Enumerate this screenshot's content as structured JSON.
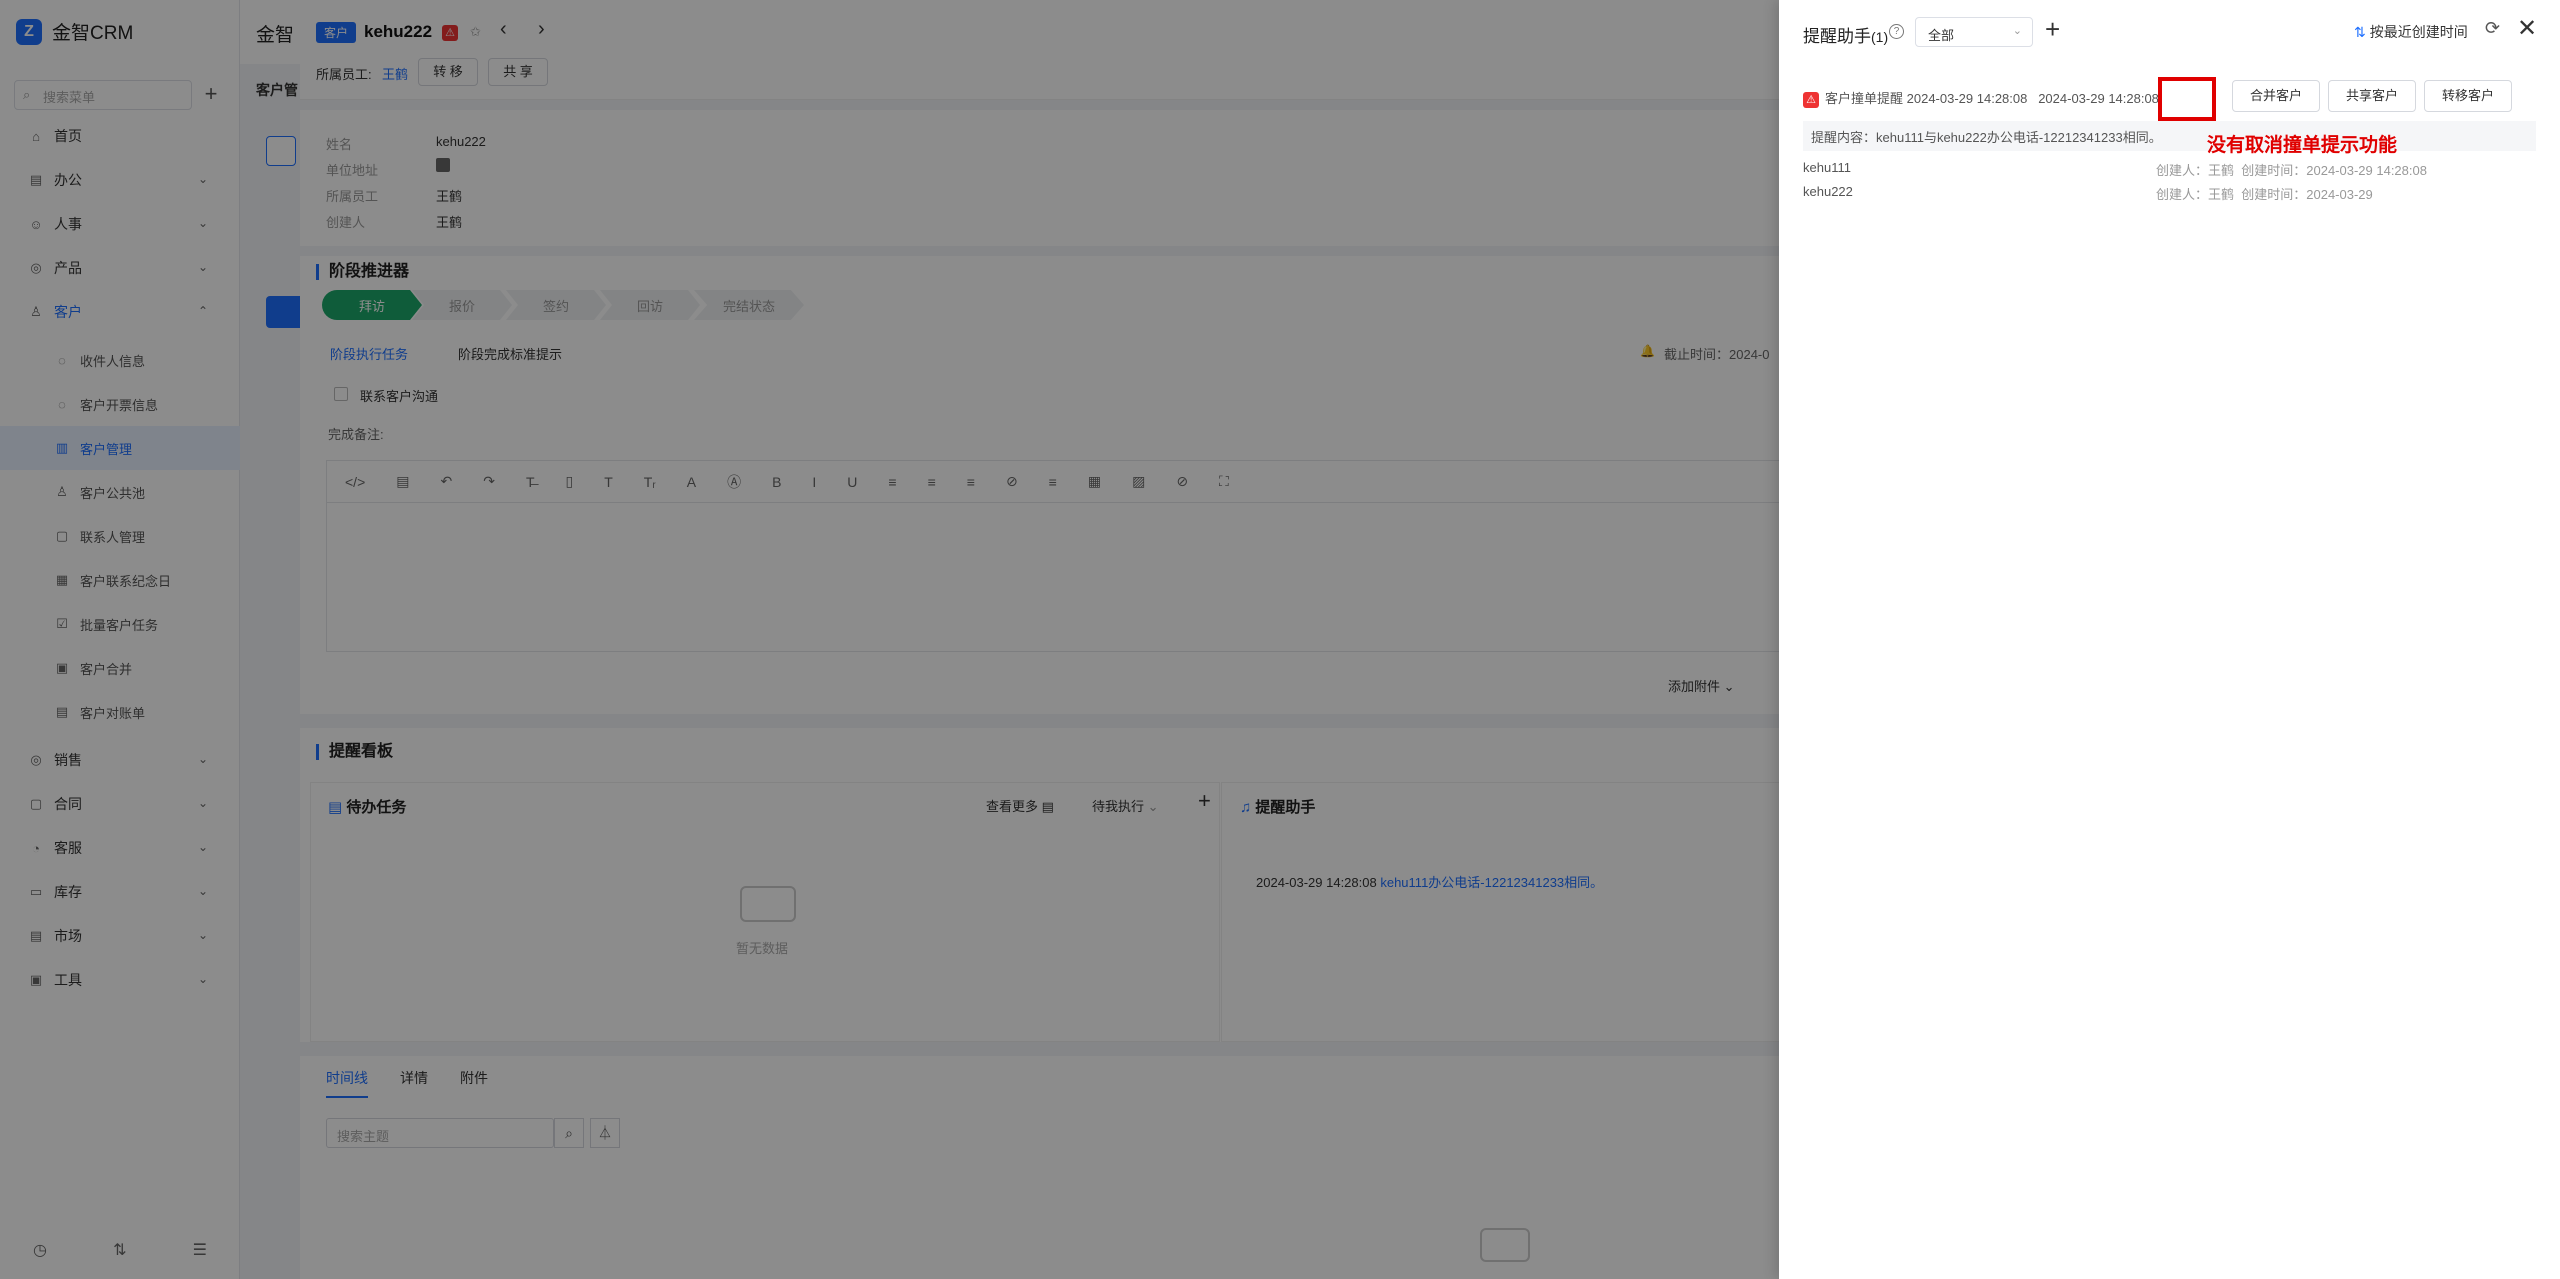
{
  "app": {
    "logo": "金智CRM",
    "logo_mark": "Z"
  },
  "sidebar": {
    "search_placeholder": "搜索菜单",
    "items": [
      {
        "label": "首页",
        "icon": "⌂"
      },
      {
        "label": "办公",
        "icon": "▤"
      },
      {
        "label": "人事",
        "icon": "☺"
      },
      {
        "label": "产品",
        "icon": "◎"
      },
      {
        "label": "客户",
        "icon": "♙"
      },
      {
        "label": "收件人信息",
        "icon": "◌"
      },
      {
        "label": "客户开票信息",
        "icon": "◌"
      },
      {
        "label": "客户管理",
        "icon": "▥"
      },
      {
        "label": "客户公共池",
        "icon": "♙"
      },
      {
        "label": "联系人管理",
        "icon": "▢"
      },
      {
        "label": "客户联系纪念日",
        "icon": "▦"
      },
      {
        "label": "批量客户任务",
        "icon": "☑"
      },
      {
        "label": "客户合并",
        "icon": "▣"
      },
      {
        "label": "客户对账单",
        "icon": "▤"
      },
      {
        "label": "销售",
        "icon": "◎"
      },
      {
        "label": "合同",
        "icon": "▢"
      },
      {
        "label": "客服",
        "icon": "◔"
      },
      {
        "label": "库存",
        "icon": "▭"
      },
      {
        "label": "市场",
        "icon": "▤"
      },
      {
        "label": "工具",
        "icon": "▣"
      }
    ]
  },
  "behind": {
    "title": "金智",
    "tab": "客户管"
  },
  "detail": {
    "tag": "客户",
    "name": "kehu222",
    "owner_label": "所属员工:",
    "owner": "王鹤",
    "transfer_btn": "转 移",
    "share_btn": "共 享",
    "fields": [
      {
        "label": "姓名",
        "value": "kehu222"
      },
      {
        "label": "单位地址",
        "value": ""
      },
      {
        "label": "所属员工",
        "value": "王鹤"
      },
      {
        "label": "创建人",
        "value": "王鹤"
      }
    ],
    "stage_title": "阶段推进器",
    "stages": [
      "拜访",
      "报价",
      "签约",
      "回访",
      "完结状态"
    ],
    "stage_tabs": [
      "阶段执行任务",
      "阶段完成标准提示"
    ],
    "deadline_label": "截止时间：2024-0",
    "contact_task": "联系客户沟通",
    "note_label": "完成备注:",
    "toolbar_icons": [
      "</>",
      "▤",
      "↶",
      "↷",
      "T̶",
      "▯",
      "T",
      "Tᵣ",
      "A",
      "Ⓐ",
      "B",
      "I",
      "U",
      "≡",
      "≡",
      "≡",
      "⊘",
      "≡",
      "▦",
      "▨",
      "⊘",
      "⛶"
    ],
    "attach_label": "添加附件",
    "board_title": "提醒看板",
    "todo_title": "待办任务",
    "todo_more": "查看更多",
    "todo_filter": "待我执行",
    "empty_text": "暂无数据",
    "assistant_title": "提醒助手",
    "assistant_item_time": "2024-03-29 14:28:08",
    "assistant_item_text": "kehu111办公电话-12212341233相同。",
    "bottom_tabs": [
      "时间线",
      "详情",
      "附件"
    ],
    "search_placeholder": "搜索主题"
  },
  "drawer": {
    "title": "提醒助手",
    "count": "(1)",
    "filter": "全部",
    "sort": "按最近创建时间",
    "reminder": {
      "type": "客户撞单提醒",
      "time1": "2024-03-29 14:28:08",
      "time2": "2024-03-29 14:28:08",
      "content": "提醒内容：kehu111与kehu222办公电话-12212341233相同。",
      "buttons": [
        "合并客户",
        "共享客户",
        "转移客户"
      ]
    },
    "rows": [
      {
        "name": "kehu111",
        "creator": "创建人：王鹤",
        "created": "创建时间：2024-03-29 14:28:08"
      },
      {
        "name": "kehu222",
        "creator": "创建人：王鹤",
        "created": "创建时间：2024-03-29"
      }
    ]
  },
  "annotation": {
    "note": "没有取消撞单提示功能"
  }
}
